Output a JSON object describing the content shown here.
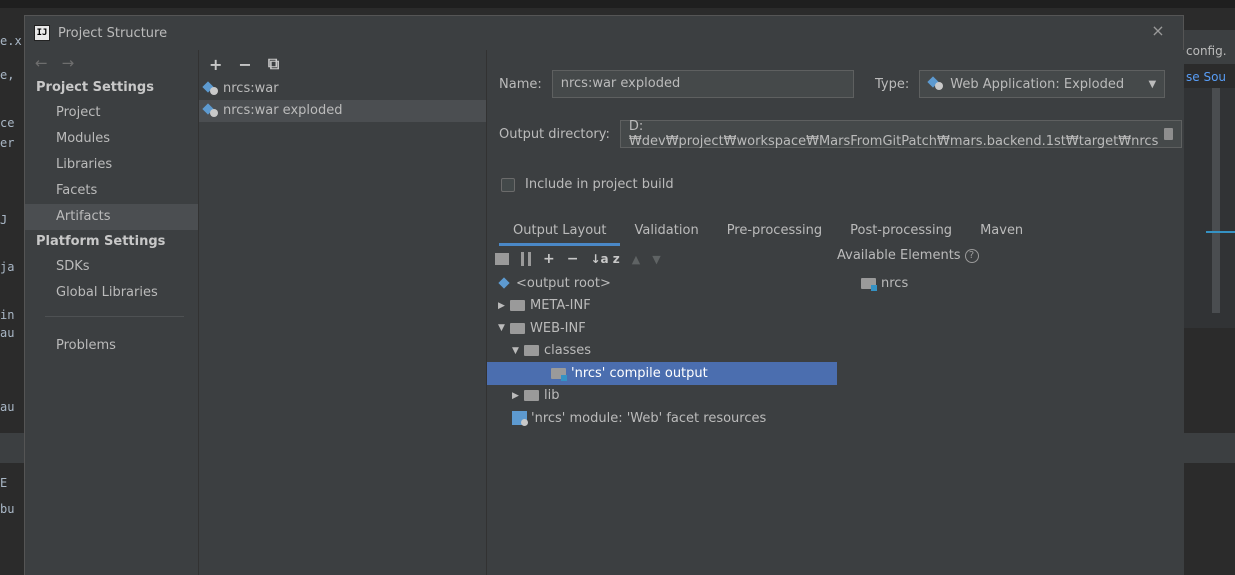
{
  "background": {
    "left_fragments": [
      "e.x",
      "e,",
      "ce",
      "er",
      "J",
      "ja",
      "in",
      "au",
      "au",
      "E",
      "bu"
    ],
    "right_tab": "config.",
    "right_link": "se Sou"
  },
  "dialog": {
    "title": "Project Structure",
    "close": "×",
    "nav": {
      "back": "←",
      "forward": "→",
      "project_settings_label": "Project Settings",
      "project_items": [
        "Project",
        "Modules",
        "Libraries",
        "Facets",
        "Artifacts"
      ],
      "platform_settings_label": "Platform Settings",
      "platform_items": [
        "SDKs",
        "Global Libraries"
      ],
      "problems": "Problems"
    },
    "artifact_toolbar": {
      "add": "+",
      "remove": "−",
      "copy": "⧉"
    },
    "artifacts": [
      "nrcs:war",
      "nrcs:war exploded"
    ],
    "name_label": "Name:",
    "name_value": "nrcs:war exploded",
    "type_label": "Type:",
    "type_value": "Web Application: Exploded",
    "output_dir_label": "Output directory:",
    "output_dir_value": "D:₩dev₩project₩workspace₩MarsFromGitPatch₩mars.backend.1st₩target₩nrcs",
    "include_label": "Include in project build",
    "tabs": [
      "Output Layout",
      "Validation",
      "Pre-processing",
      "Post-processing",
      "Maven"
    ],
    "layout_toolbar": {
      "add": "+",
      "remove": "−",
      "sort": "↓a z"
    },
    "available_label": "Available Elements",
    "tree": {
      "root": "<output root>",
      "meta_inf": "META-INF",
      "web_inf": "WEB-INF",
      "classes": "classes",
      "compile_output": "'nrcs' compile output",
      "lib": "lib",
      "facet_resources": "'nrcs' module: 'Web' facet resources"
    },
    "available_items": [
      "nrcs"
    ]
  }
}
